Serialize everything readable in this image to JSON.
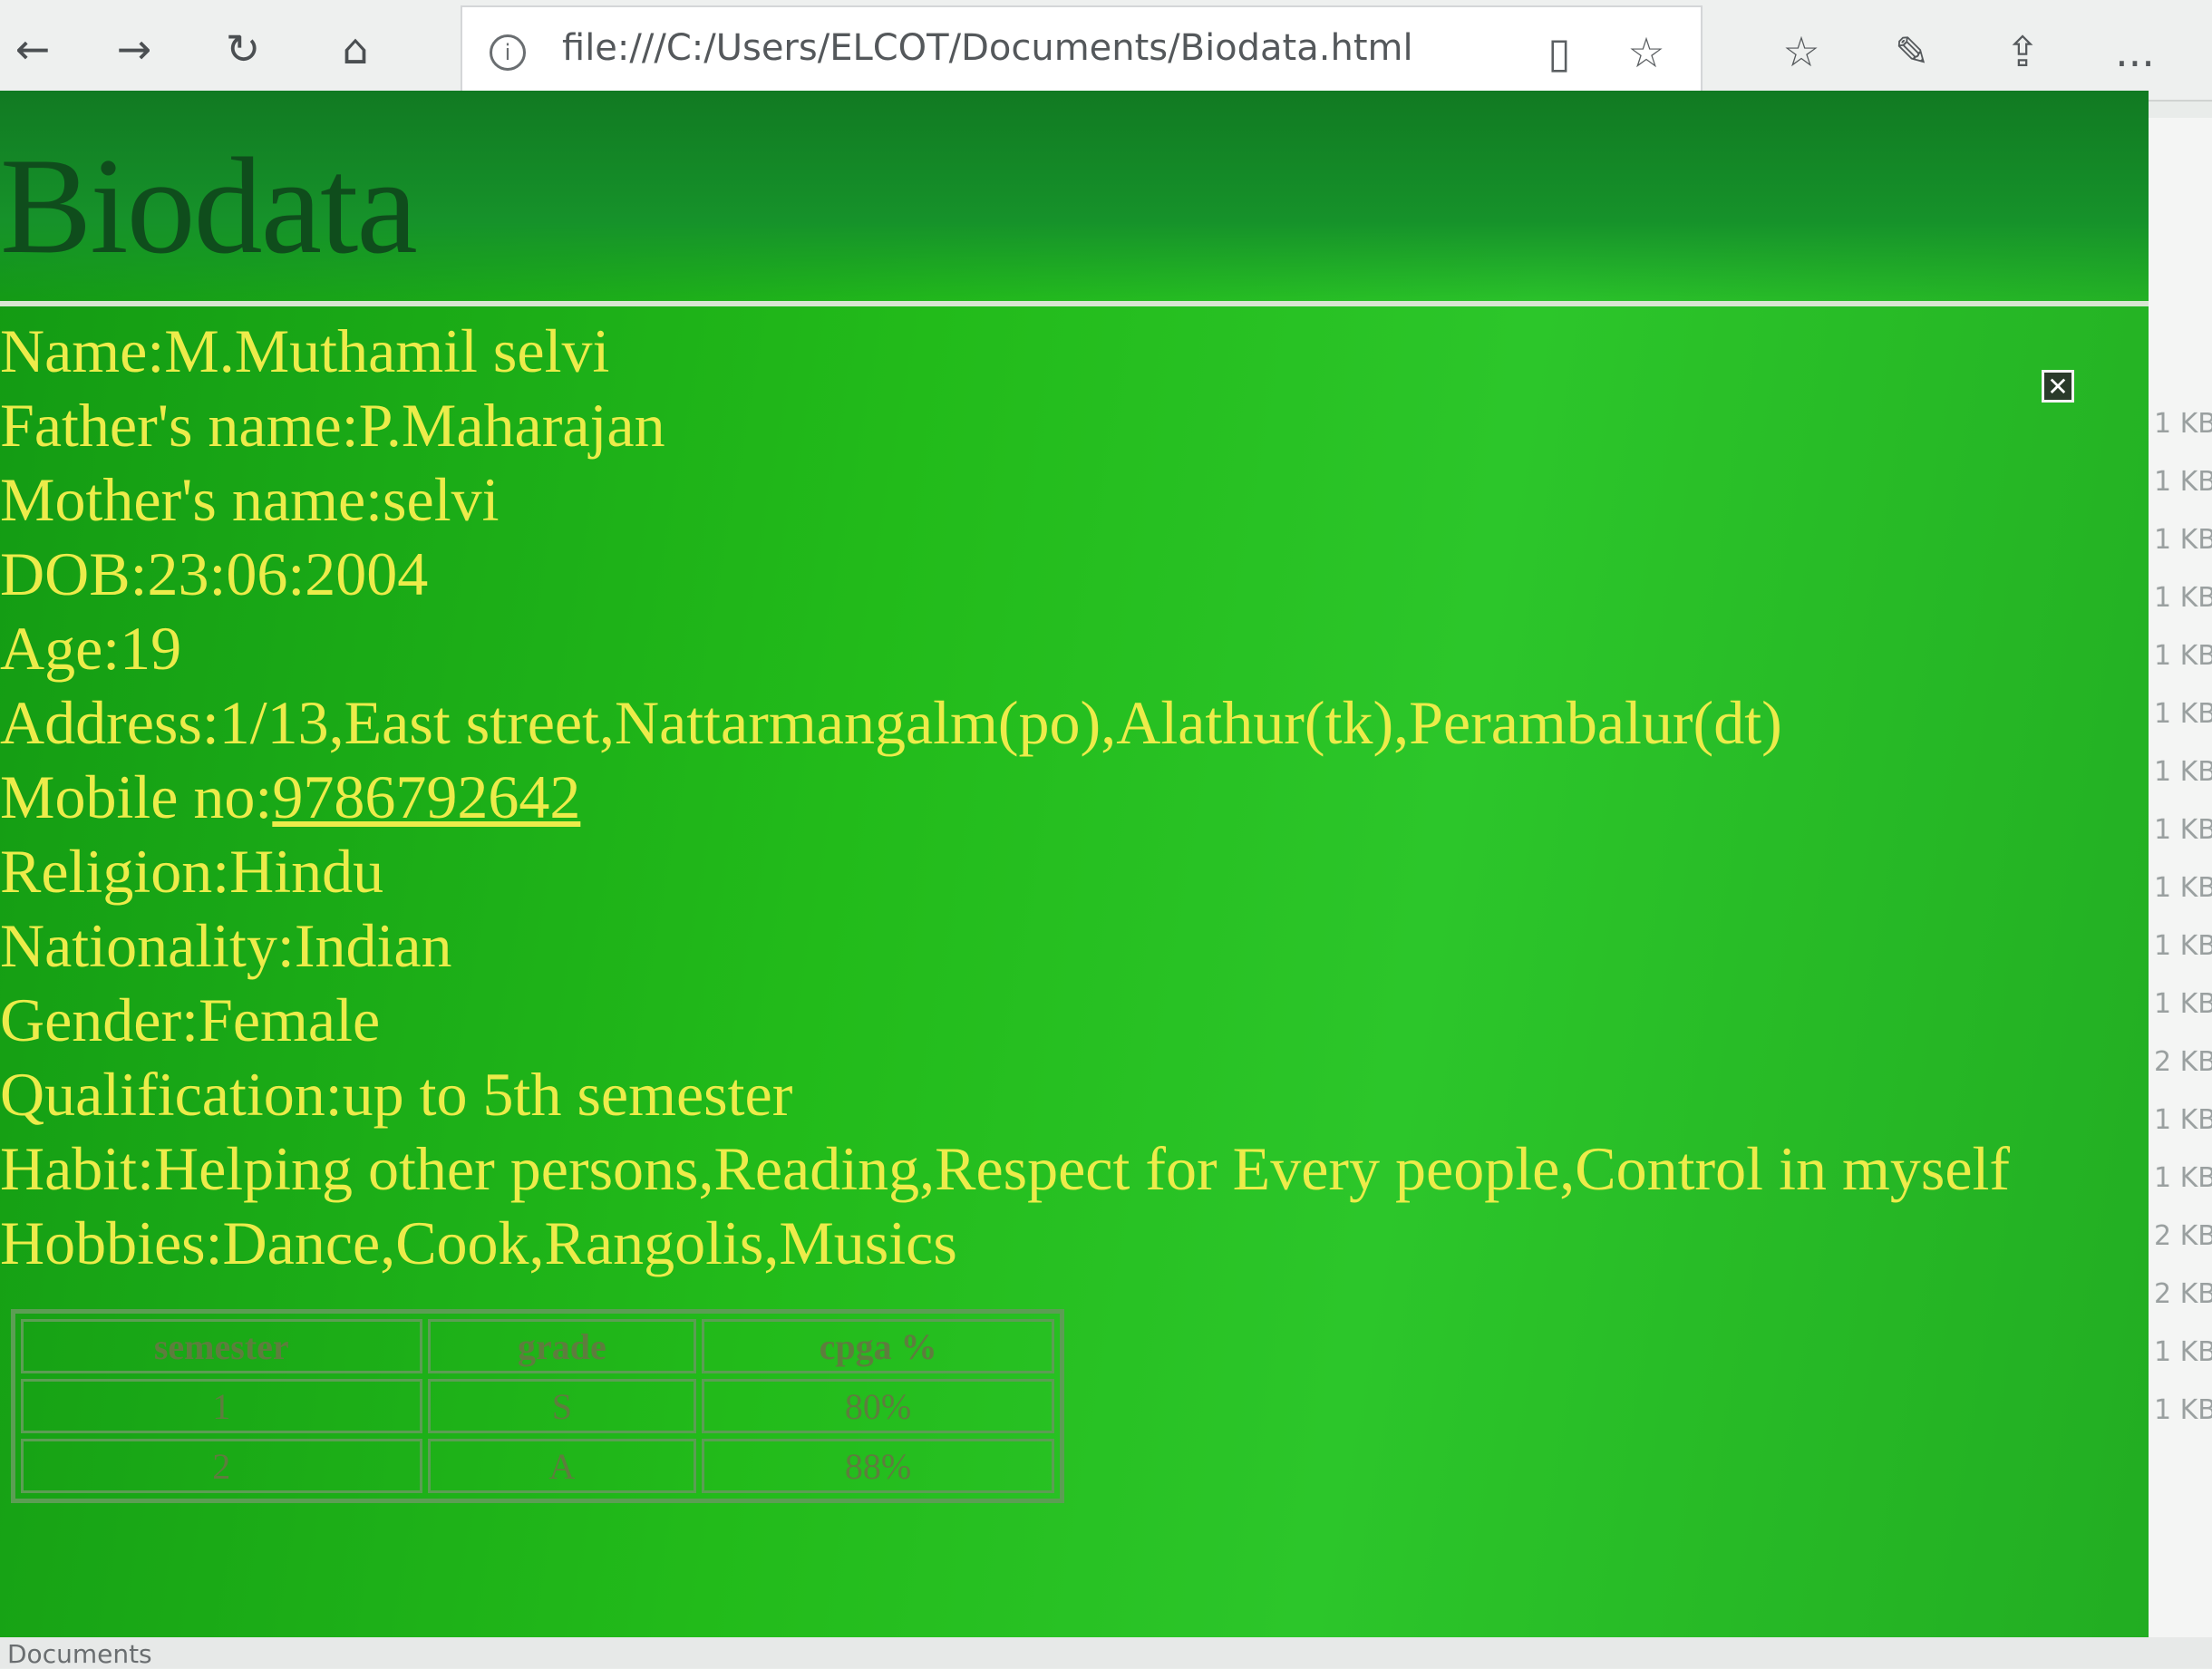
{
  "browser": {
    "url": "file:///C:/Users/ELCOT/Documents/Biodata.html",
    "icons": [
      "back-icon",
      "forward-icon",
      "refresh-icon",
      "home-icon",
      "info-icon",
      "reading-view-icon",
      "favorite-star-icon",
      "favorites-list-icon",
      "pen-icon",
      "share-icon",
      "more-icon"
    ],
    "more": "..."
  },
  "page": {
    "title": "Biodata",
    "close": "✕",
    "details": [
      "Name:M.Muthamil selvi",
      "Father's name:P.Maharajan",
      "Mother's name:selvi",
      "DOB:23:06:2004",
      "Age:19",
      "Address:1/13,East street,Nattarmangalm(po),Alathur(tk),Perambalur(dt)",
      "Mobile no:",
      "Religion:Hindu",
      "Nationality:Indian",
      "Gender:Female",
      "Qualification:up to 5th semester",
      "Habit:Helping other persons,Reading,Respect for Every people,Control in myself",
      "Hobbies:Dance,Cook,Rangolis,Musics"
    ],
    "mobile_link": "9786792642",
    "background_color": "#22bb1a",
    "text_color": "#ecec4a",
    "title_color": "#0f4d1c"
  },
  "table": {
    "headers": [
      "semester",
      "grade",
      "cpga %"
    ],
    "rows": [
      [
        "1",
        "S",
        "80%"
      ],
      [
        "2",
        "A",
        "88%"
      ]
    ]
  },
  "side_panel": {
    "items": [
      "1 KB",
      "1 KB",
      "1 KB",
      "1 KB",
      "1 KB",
      "1 KB",
      "1 KB",
      "1 KB",
      "1 KB",
      "1 KB",
      "1 KB",
      "2 KB",
      "1 KB",
      "1 KB",
      "2 KB",
      "2 KB",
      "1 KB",
      "1 KB"
    ]
  },
  "status": {
    "text": "Documents"
  }
}
